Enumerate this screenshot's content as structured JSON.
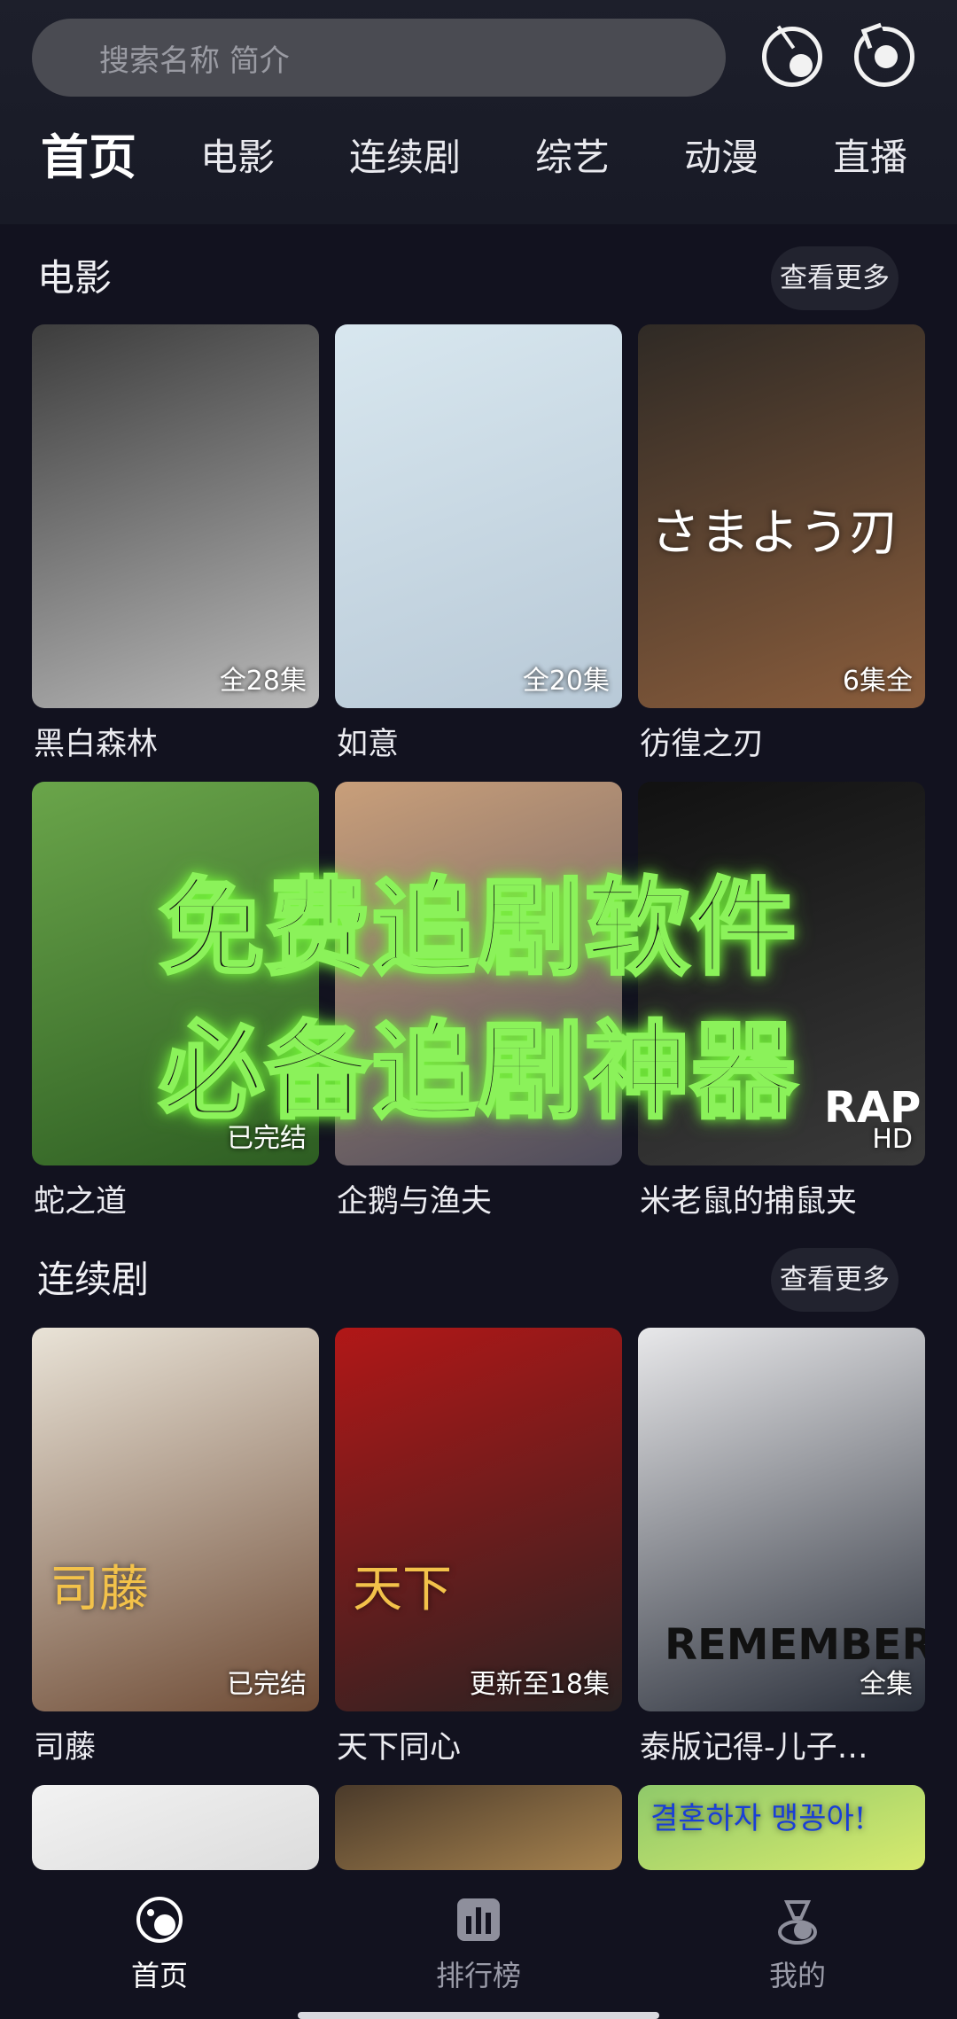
{
  "search": {
    "placeholder": "搜索名称 简介"
  },
  "tabs": [
    {
      "label": "首页"
    },
    {
      "label": "电影"
    },
    {
      "label": "连续剧"
    },
    {
      "label": "综艺"
    },
    {
      "label": "动漫"
    },
    {
      "label": "直播"
    }
  ],
  "sections": {
    "movies": {
      "title": "电影",
      "more": "查看更多",
      "items": [
        {
          "title": "黑白森林",
          "badge": "全28集",
          "poster_colors": [
            "#3d3d3d",
            "#b9b9b9"
          ]
        },
        {
          "title": "如意",
          "badge": "全20集",
          "poster_colors": [
            "#d8e7ef",
            "#b8c9d7"
          ]
        },
        {
          "title": "彷徨之刃",
          "badge": "6集全",
          "poster_colors": [
            "#2f2a25",
            "#8a5d3c"
          ],
          "poster_text": "さまよう刃"
        },
        {
          "title": "蛇之道",
          "badge": "已完结",
          "poster_colors": [
            "#6aa54a",
            "#2d5d22"
          ]
        },
        {
          "title": "企鹅与渔夫",
          "badge": "",
          "poster_colors": [
            "#c99f7a",
            "#4e4c5c"
          ]
        },
        {
          "title": "米老鼠的捕鼠夹",
          "badge": "HD",
          "poster_colors": [
            "#111111",
            "#3a3a3a"
          ],
          "poster_text": "RAP"
        }
      ]
    },
    "series": {
      "title": "连续剧",
      "more": "查看更多",
      "items": [
        {
          "title": "司藤",
          "badge": "已完结",
          "poster_colors": [
            "#e9e3d7",
            "#6e4b35"
          ],
          "poster_text": "司藤"
        },
        {
          "title": "天下同心",
          "badge": "更新至18集",
          "poster_colors": [
            "#b11717",
            "#2a2222"
          ],
          "poster_text": "天下"
        },
        {
          "title": "泰版记得-儿子…",
          "badge": "全集",
          "poster_colors": [
            "#e8e8ea",
            "#2a2f3a"
          ],
          "poster_text": "REMEMBER"
        },
        {
          "title": "",
          "badge": "",
          "poster_colors": [
            "#f2f2f2",
            "#dcdcdc"
          ]
        },
        {
          "title": "",
          "badge": "",
          "poster_colors": [
            "#4a3a2a",
            "#a7834f"
          ]
        },
        {
          "title": "",
          "badge": "",
          "poster_colors": [
            "#8fc96a",
            "#d7ea6e"
          ],
          "poster_text": "결혼하자 맹꽁아!"
        }
      ]
    }
  },
  "promo": {
    "line1": "免费追剧软件",
    "line2": "必备追剧神器"
  },
  "bottom_nav": [
    {
      "label": "首页",
      "icon": "home-planet-icon",
      "active": true
    },
    {
      "label": "排行榜",
      "icon": "ranking-icon",
      "active": false
    },
    {
      "label": "我的",
      "icon": "profile-icon",
      "active": false
    }
  ],
  "colors": {
    "background": "#12121f",
    "promo_glow": "#7bff3a"
  }
}
